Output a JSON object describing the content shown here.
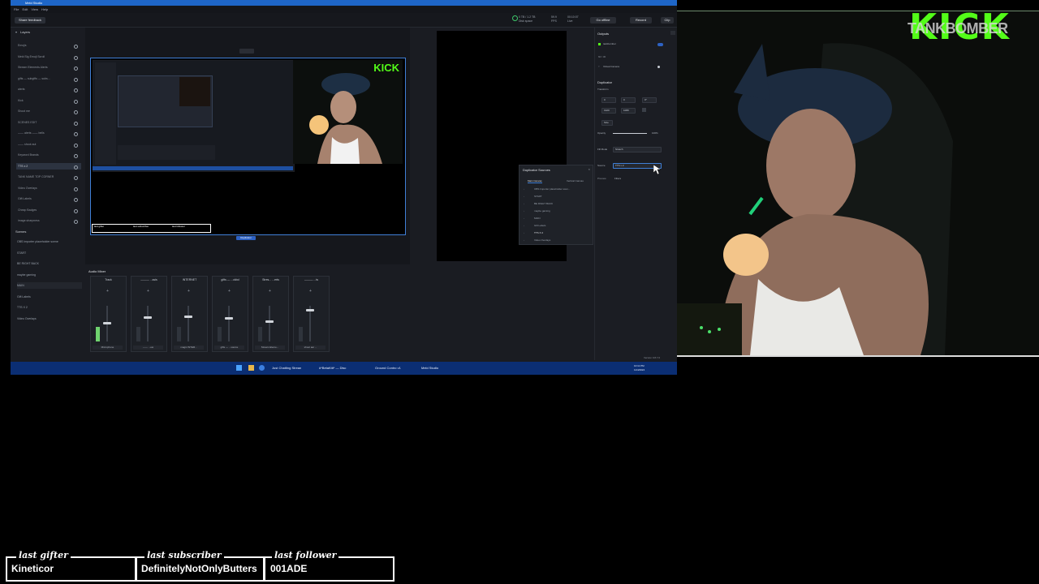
{
  "window": {
    "title": "Meld Studio",
    "menu": [
      "File",
      "Edit",
      "View",
      "Help"
    ]
  },
  "toolbar": {
    "feedback": "Share feedback",
    "disk_space": "0 TB / 1.2 TB",
    "disk_label": "Disk space",
    "fps": "59.9",
    "fps_label": "FPS",
    "time": "00:10:07",
    "time_label": "Live",
    "go_live": "Go offline",
    "record": "Record",
    "clip": "Clip"
  },
  "layers": {
    "title": "Layers",
    "items": [
      "Emojis",
      "Meld Sig Emoji Scroll",
      "Stream Elements Alerts",
      "gifts — subgifts — subs...",
      "alerts",
      "Kick",
      "Shoot me",
      "SCENES EDIT",
      "—— alerts —— bells",
      "—— shoot aut",
      "Keyword Brands",
      "TTS x 2",
      "TANK NAME TOP CORNER",
      "Video Overlays",
      "Gift Labels",
      "Cheap Badges",
      "image.sharpness"
    ],
    "selected_index": 11
  },
  "scenes": {
    "title": "Scenes",
    "items": [
      "OBS Importer placeholder scene",
      "START",
      "BE RIGHT BACK",
      "maybe gaming",
      "MAIN",
      "Gift Labels",
      "TTS X 2",
      "Video Overlays"
    ]
  },
  "preview": {
    "tag": "Duplicator",
    "kick_text": "KICK",
    "bar": [
      "last gifter",
      "last subscriber",
      "last follower"
    ]
  },
  "dup_sources": {
    "title": "Duplicator Sources",
    "tabs": [
      "Main Canvas",
      "Vertical Canvas"
    ],
    "items": [
      "OBS Importer placeholder scen...",
      "START",
      "BE RIGHT BACK",
      "maybe gaming",
      "MAIN",
      "Gift Labels",
      "TTS X 2",
      "Video Overlays"
    ]
  },
  "properties": {
    "outputs_title": "Outputs",
    "output_name": "tankbomber",
    "output_status": "60 / 30",
    "virtual_camera": "Virtual Camera",
    "duplicator_title": "Duplicator",
    "transform": "Transform",
    "x": "0",
    "y": "0",
    "rotation": "0°",
    "width": "1920",
    "height": "1080",
    "size_label": "Size",
    "opacity_label": "Opacity",
    "opacity_value": "100%",
    "fill_mode_label": "Fill Mode",
    "fill_mode_value": "Stretch",
    "source_label": "Source",
    "source_value": "TTS x 2",
    "preview_label": "Preview",
    "filters_label": "Filters",
    "version": "Version 0.8.7.0"
  },
  "mixer": {
    "title": "Audio Mixer",
    "channels": [
      {
        "name": "Track",
        "foot": "Microphone",
        "level": 0.55
      },
      {
        "name": "——— ...ssis",
        "foot": "—— ...ew",
        "level": 0.7
      },
      {
        "name": "INTERNET",
        "foot": "magic INTER...",
        "level": 0.72
      },
      {
        "name": "gifts — ...ckbd",
        "foot": "gifts — ...source",
        "level": 0.68
      },
      {
        "name": "Stres... ...erts",
        "foot": "Stream Eleme...",
        "level": 0.6
      },
      {
        "name": "——— ...ts",
        "foot": "shoot aut ...",
        "level": 0.9
      }
    ]
  },
  "taskbar": {
    "items": [
      "Just Chatting Strean",
      "#*BetaKitt* — Disc",
      "Ground Contro v1",
      "Meld Studio"
    ],
    "time": "10:11 PM",
    "date": "11/4/2024"
  },
  "overlay": {
    "streamer_tag": "TANKBOMBER",
    "kick_logo": "KICK",
    "last_gifter_label": "last gifter",
    "last_gifter": "Kineticor",
    "last_subscriber_label": "last subscriber",
    "last_subscriber": "DefinitelyNotOnlyButters",
    "last_follower_label": "last follower",
    "last_follower": "001ADE"
  },
  "colors": {
    "kick_green": "#53fc18",
    "taskbar": "#0b2e73",
    "accent": "#3f7fd6"
  }
}
